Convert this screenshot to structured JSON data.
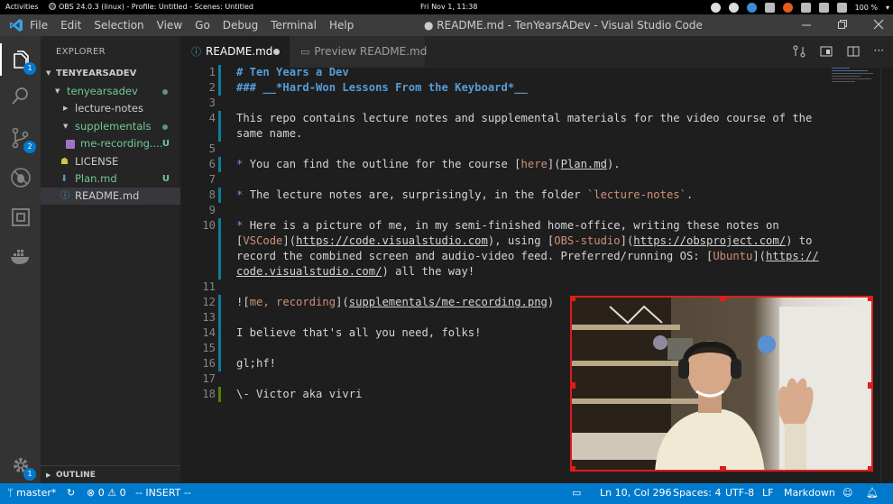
{
  "gnome": {
    "activities": "Activities",
    "app_title": "OBS 24.0.3 (linux) - Profile: Untitled - Scenes: Untitled",
    "clock": "Fri Nov  1, 11:38",
    "battery": "100 %"
  },
  "titlebar": {
    "menus": [
      "File",
      "Edit",
      "Selection",
      "View",
      "Go",
      "Debug",
      "Terminal",
      "Help"
    ],
    "window_title": "● README.md - TenYearsADev - Visual Studio Code"
  },
  "activity": {
    "explorer_badge": "1",
    "scm_badge": "2",
    "settings_badge": "1"
  },
  "sidebar": {
    "title": "EXPLORER",
    "root": "TENYEARSADEV",
    "tree": [
      {
        "label": "tenyearsadev",
        "status": "dot"
      },
      {
        "label": "lecture-notes",
        "status": ""
      },
      {
        "label": "supplementals",
        "status": "dot"
      },
      {
        "label": "me-recording....",
        "status": "U"
      },
      {
        "label": "LICENSE",
        "status": ""
      },
      {
        "label": "Plan.md",
        "status": "U"
      },
      {
        "label": "README.md",
        "status": ""
      }
    ],
    "outline": "OUTLINE"
  },
  "tabs": [
    {
      "label": "README.md",
      "icon": "info-icon",
      "active": true,
      "dirty": true
    },
    {
      "label": "Preview README.md",
      "icon": "preview-icon",
      "active": false
    }
  ],
  "editor": {
    "lines": {
      "l1": "# Ten Years a Dev",
      "l2": "### __*Hard-Won Lessons From the Keyboard*__",
      "l4a": "This repo contains lecture notes and supplemental materials for the video course of the",
      "l4b": "same name.",
      "l6_bullet": "* ",
      "l6_pre": "You can find the outline for the course [",
      "l6_link": "here",
      "l6_mid": "](",
      "l6_url": "Plan.md",
      "l6_post": ").",
      "l8_bullet": "* ",
      "l8_pre": "The lecture notes are, surprisingly, in the folder ",
      "l8_code": "`lecture-notes`",
      "l8_post": ".",
      "l10_bullet": "* ",
      "l10a": "Here is a picture of me, in my semi-finished home-office, writing these notes on",
      "l10b_1": "[",
      "l10b_link1": "VSCode",
      "l10b_2": "](",
      "l10b_url1": "https://code.visualstudio.com",
      "l10b_3": "), using [",
      "l10b_link2": "OBS-studio",
      "l10b_4": "](",
      "l10b_url2": "https://obsproject.com/",
      "l10b_5": ") to",
      "l10c_1": "record the combined screen and audio-video feed. Preferred/running OS: [",
      "l10c_link": "Ubuntu",
      "l10c_2": "](",
      "l10c_url": "https://",
      "l10d_url": "code.visualstudio.com/",
      "l10d_post": ") all the way!",
      "l12_1": "![",
      "l12_link": "me, recording",
      "l12_2": "](",
      "l12_url": "supplementals/me-recording.png",
      "l12_3": ")",
      "l14": "I believe that's all you need, folks!",
      "l16": "gl;hf!",
      "l18": "\\- Victor aka vivri"
    },
    "line_numbers": [
      "1",
      "2",
      "3",
      "4",
      "5",
      "6",
      "7",
      "8",
      "9",
      "10",
      "11",
      "12",
      "13",
      "14",
      "15",
      "16",
      "17",
      "18"
    ]
  },
  "statusbar": {
    "branch": "master*",
    "sync": "↻",
    "errors": "0",
    "warnings": "0",
    "mode": "-- INSERT --",
    "position": "Ln 10, Col 296",
    "spaces": "Spaces: 4",
    "encoding": "UTF-8",
    "eol": "LF",
    "language": "Markdown"
  },
  "colors": {
    "accent": "#007acc",
    "obs_selection": "#e01b1b",
    "git_added": "#73c991"
  }
}
